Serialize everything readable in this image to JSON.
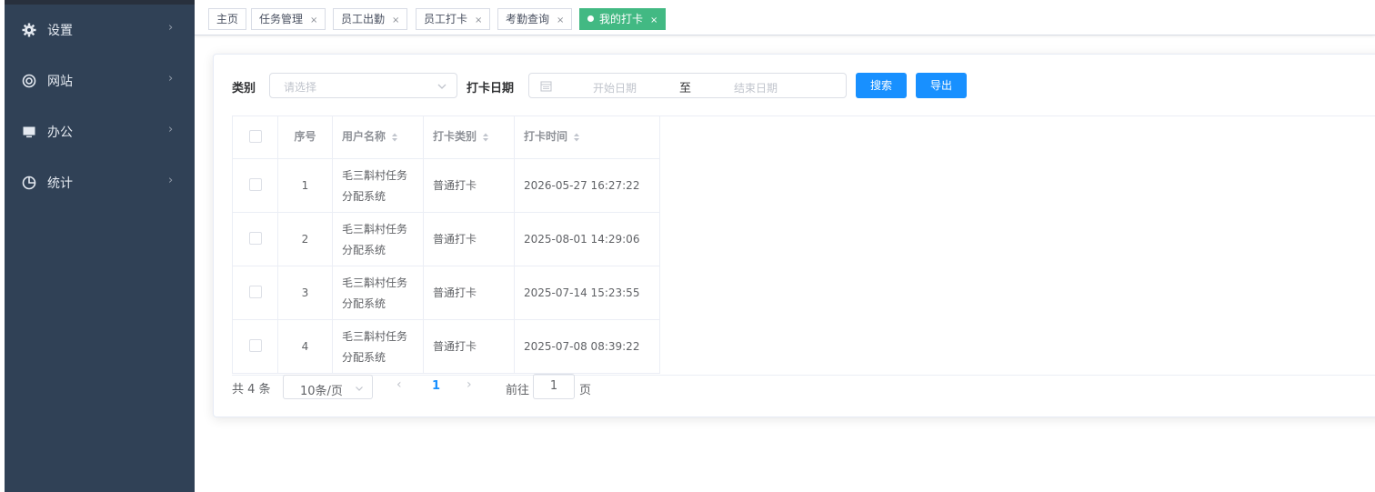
{
  "sidebar": {
    "items": [
      {
        "label": "设置",
        "icon": "gear-icon"
      },
      {
        "label": "网站",
        "icon": "lifebuoy-icon"
      },
      {
        "label": "办公",
        "icon": "monitor-icon"
      },
      {
        "label": "统计",
        "icon": "pie-chart-icon"
      }
    ]
  },
  "tabs": [
    {
      "label": "主页",
      "closable": false,
      "active": false
    },
    {
      "label": "任务管理",
      "closable": true,
      "active": false
    },
    {
      "label": "员工出勤",
      "closable": true,
      "active": false
    },
    {
      "label": "员工打卡",
      "closable": true,
      "active": false
    },
    {
      "label": "考勤查询",
      "closable": true,
      "active": false
    },
    {
      "label": "我的打卡",
      "closable": true,
      "active": true
    }
  ],
  "tab_close_glyph": "×",
  "filters": {
    "category_label": "类别",
    "category_placeholder": "请选择",
    "date_label": "打卡日期",
    "start_placeholder": "开始日期",
    "range_separator": "至",
    "end_placeholder": "结束日期",
    "search_label": "搜索",
    "export_label": "导出"
  },
  "table": {
    "headers": {
      "index": "序号",
      "username": "用户名称",
      "type": "打卡类别",
      "time": "打卡时间"
    },
    "rows": [
      {
        "index": "1",
        "username_line1": "毛三斠村任务",
        "username_line2": "分配系统",
        "type": "普通打卡",
        "time": "2026-05-27 16:27:22"
      },
      {
        "index": "2",
        "username_line1": "毛三斠村任务",
        "username_line2": "分配系统",
        "type": "普通打卡",
        "time": "2025-08-01 14:29:06"
      },
      {
        "index": "3",
        "username_line1": "毛三斠村任务",
        "username_line2": "分配系统",
        "type": "普通打卡",
        "time": "2025-07-14 15:23:55"
      },
      {
        "index": "4",
        "username_line1": "毛三斠村任务",
        "username_line2": "分配系统",
        "type": "普通打卡",
        "time": "2025-07-08 08:39:22"
      }
    ]
  },
  "pagination": {
    "total": "共 4 条",
    "page_size": "10条/页",
    "current_page": "1",
    "goto_label": "前往",
    "goto_value": "1",
    "goto_suffix": "页"
  },
  "colors": {
    "sidebar_bg": "#304156",
    "active_tab": "#42b983",
    "primary": "#1890ff"
  }
}
